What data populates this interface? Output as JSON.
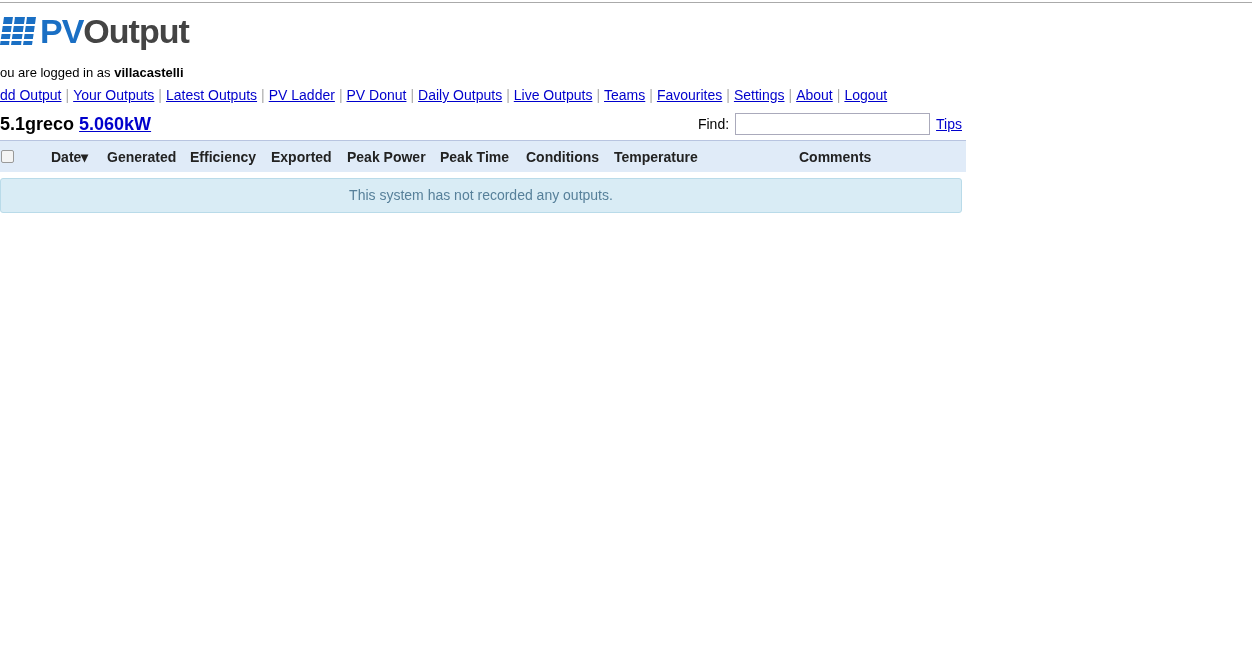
{
  "logo": {
    "text_a": "PV",
    "text_b": "Output"
  },
  "login": {
    "prefix": "ou are logged in as",
    "user": "villacastelli"
  },
  "nav": [
    {
      "label": "dd Output"
    },
    {
      "label": "Your Outputs"
    },
    {
      "label": "Latest Outputs"
    },
    {
      "label": "PV Ladder"
    },
    {
      "label": "PV Donut"
    },
    {
      "label": "Daily Outputs"
    },
    {
      "label": "Live Outputs"
    },
    {
      "label": "Teams"
    },
    {
      "label": "Favourites"
    },
    {
      "label": "Settings"
    },
    {
      "label": "About"
    },
    {
      "label": "Logout"
    }
  ],
  "nav_separator": "|",
  "system": {
    "name": "5.1greco",
    "size": "5.060kW"
  },
  "find": {
    "label": "Find:",
    "tips": "Tips"
  },
  "table": {
    "select_all": {
      "checked": false
    },
    "columns": [
      {
        "label": "Date▾"
      },
      {
        "label": "Generated"
      },
      {
        "label": "Efficiency"
      },
      {
        "label": "Exported"
      },
      {
        "label": "Peak Power"
      },
      {
        "label": "Peak Time"
      },
      {
        "label": "Conditions"
      },
      {
        "label": "Temperature"
      },
      {
        "label": "Comments"
      }
    ],
    "empty_message": "This system has not recorded any outputs."
  }
}
